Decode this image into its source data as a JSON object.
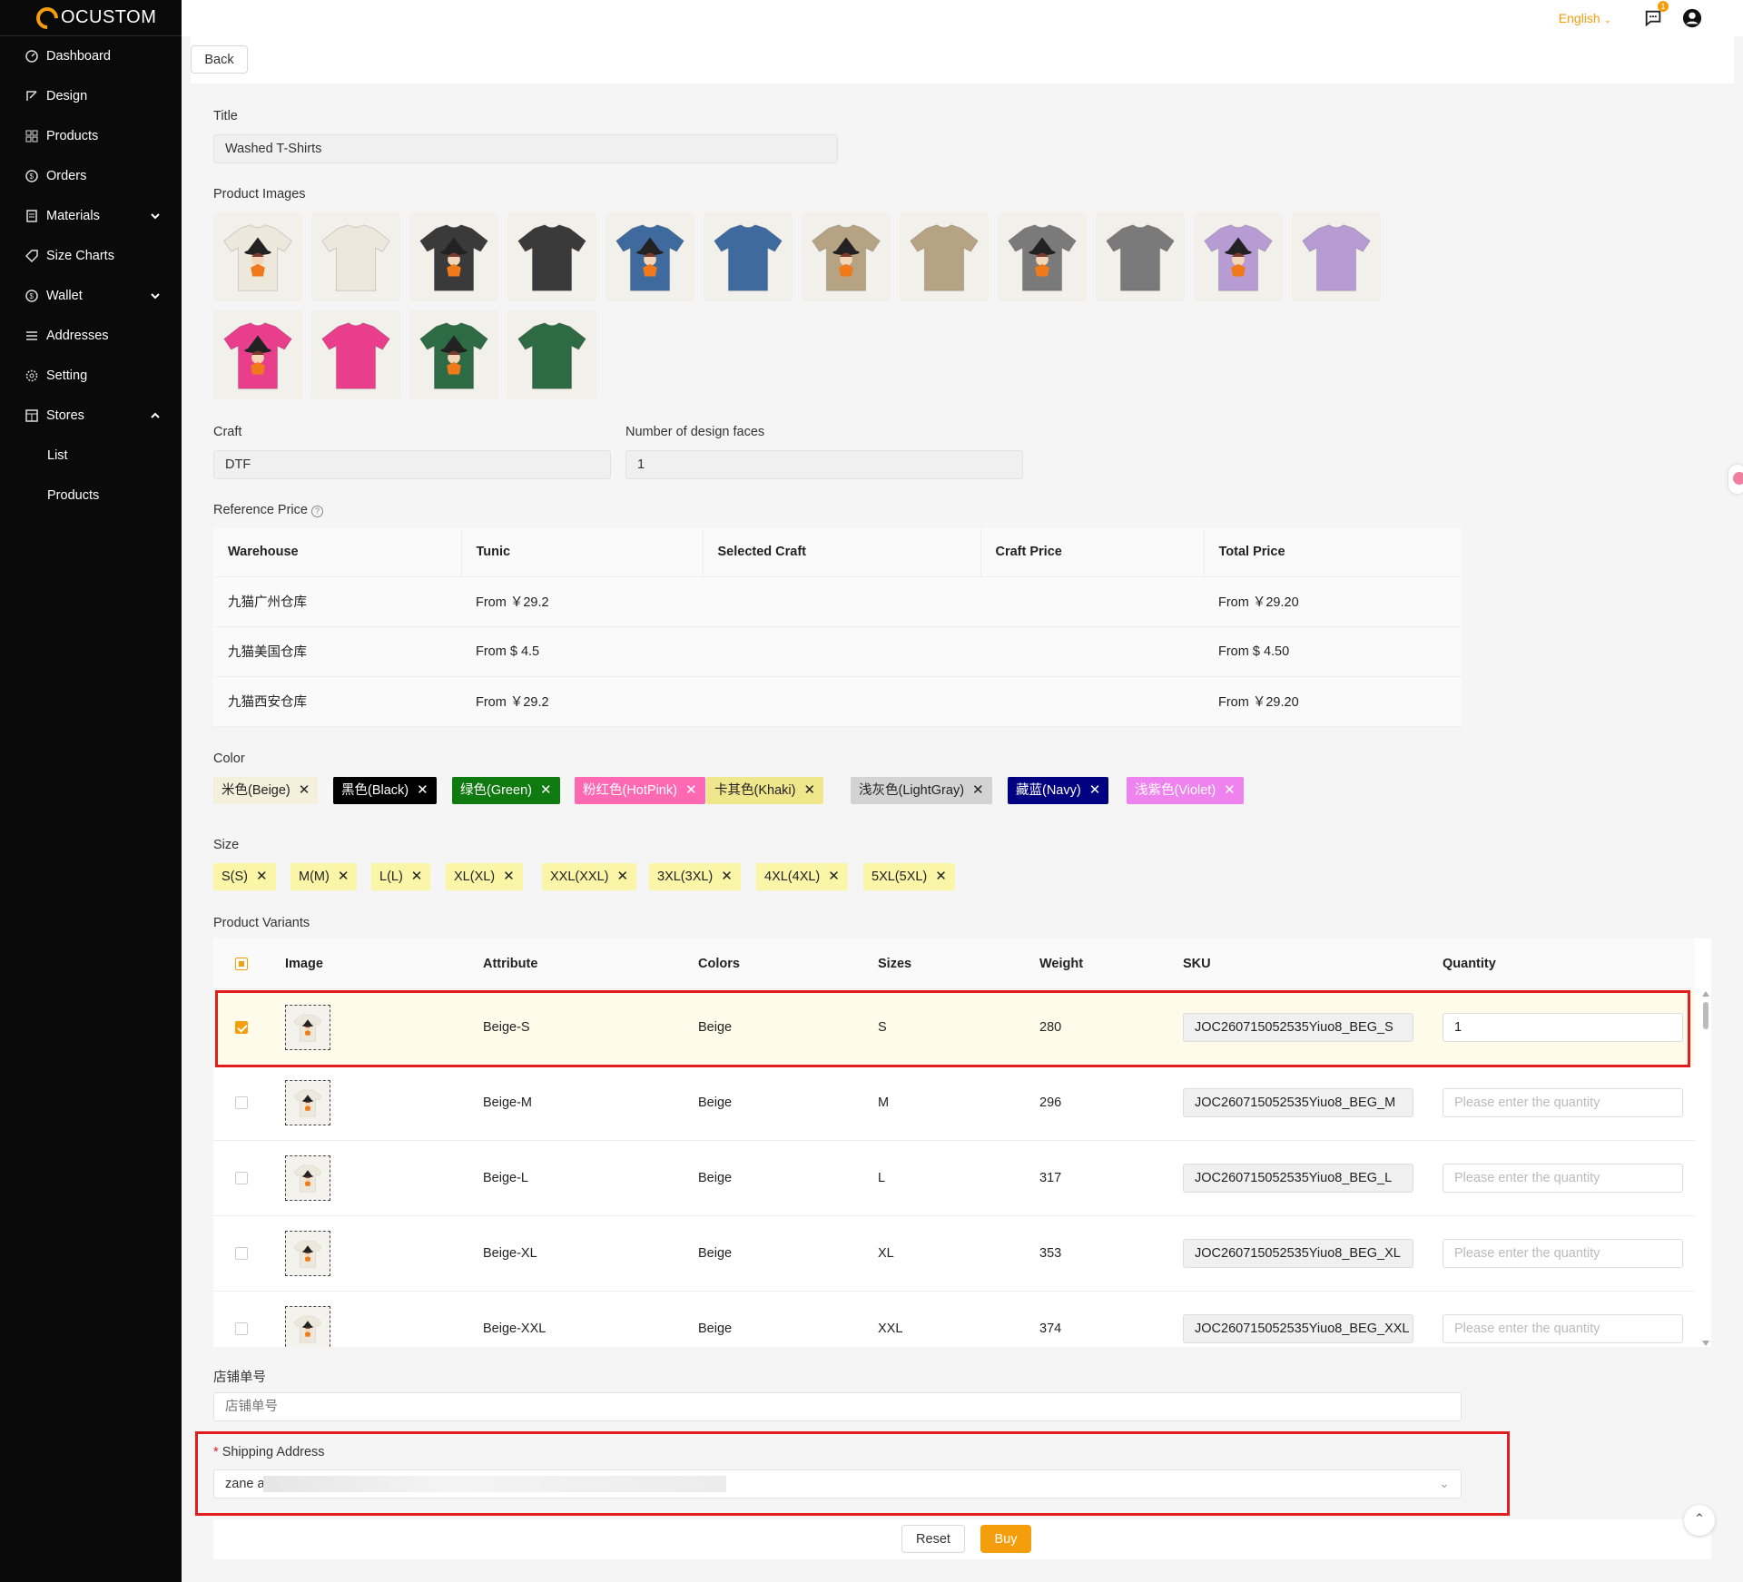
{
  "brand": {
    "name": "OCUSTOM",
    "accent": "#f59e0b"
  },
  "sidebar": {
    "items": [
      {
        "label": "Dashboard",
        "icon": "dashboard-icon"
      },
      {
        "label": "Design",
        "icon": "design-icon"
      },
      {
        "label": "Products",
        "icon": "products-icon"
      },
      {
        "label": "Orders",
        "icon": "orders-icon"
      },
      {
        "label": "Materials",
        "icon": "materials-icon",
        "chevron": "down"
      },
      {
        "label": "Size Charts",
        "icon": "tag-icon"
      },
      {
        "label": "Wallet",
        "icon": "wallet-icon",
        "chevron": "down"
      },
      {
        "label": "Addresses",
        "icon": "list-icon"
      },
      {
        "label": "Setting",
        "icon": "gear-icon"
      },
      {
        "label": "Stores",
        "icon": "store-icon",
        "chevron": "up"
      }
    ],
    "sub": [
      "List",
      "Products"
    ]
  },
  "topbar": {
    "language": "English",
    "badge_count": "1"
  },
  "toolbar": {
    "back": "Back"
  },
  "form": {
    "title_label": "Title",
    "title_value": "Washed T-Shirts",
    "images_label": "Product Images",
    "craft_label": "Craft",
    "craft_value": "DTF",
    "faces_label": "Number of design faces",
    "faces_value": "1",
    "ref_label": "Reference Price",
    "color_label": "Color",
    "size_label": "Size",
    "variants_label": "Product Variants",
    "store_no_label": "店铺单号",
    "store_no_placeholder": "店铺单号",
    "ship_required": "*",
    "ship_label": "Shipping Address",
    "ship_value": "zane a"
  },
  "images": [
    {
      "color": "#ece8dc",
      "design": true
    },
    {
      "color": "#ece8dc",
      "design": false
    },
    {
      "color": "#3a3a3a",
      "design": true
    },
    {
      "color": "#3a3a3a",
      "design": false
    },
    {
      "color": "#3f6a9e",
      "design": true
    },
    {
      "color": "#3f6a9e",
      "design": false
    },
    {
      "color": "#b6a383",
      "design": true
    },
    {
      "color": "#b6a383",
      "design": false
    },
    {
      "color": "#7a7a7a",
      "design": true
    },
    {
      "color": "#7a7a7a",
      "design": false
    },
    {
      "color": "#b69cd3",
      "design": true
    },
    {
      "color": "#b69cd3",
      "design": false
    },
    {
      "color": "#e83e8c",
      "design": true
    },
    {
      "color": "#e83e8c",
      "design": false
    },
    {
      "color": "#2e6b44",
      "design": true
    },
    {
      "color": "#2e6b44",
      "design": false
    }
  ],
  "ref_table": {
    "headers": [
      "Warehouse",
      "Tunic",
      "Selected Craft",
      "Craft Price",
      "Total Price"
    ],
    "rows": [
      [
        "九猫广州仓库",
        "From ￥29.2",
        "",
        "",
        "From ￥29.20"
      ],
      [
        "九猫美国仓库",
        "From $ 4.5",
        "",
        "",
        "From $ 4.50"
      ],
      [
        "九猫西安仓库",
        "From ￥29.2",
        "",
        "",
        "From ￥29.20"
      ]
    ]
  },
  "colors": [
    {
      "label": "米色(Beige)",
      "bg": "#f5f0dc",
      "fg": "#222"
    },
    {
      "label": "黑色(Black)",
      "bg": "#000000",
      "fg": "#fff"
    },
    {
      "label": "绿色(Green)",
      "bg": "#0f7a0f",
      "fg": "#fff"
    },
    {
      "label": "粉红色(HotPink)",
      "bg": "#ff69b4",
      "fg": "#fff"
    },
    {
      "label": "卡其色(Khaki)",
      "bg": "#f0e68c",
      "fg": "#222"
    },
    {
      "label": "浅灰色(LightGray)",
      "bg": "#d3d3d3",
      "fg": "#222"
    },
    {
      "label": "藏蓝(Navy)",
      "bg": "#000080",
      "fg": "#fff"
    },
    {
      "label": "浅紫色(Violet)",
      "bg": "#ee82ee",
      "fg": "#fff"
    }
  ],
  "sizes": [
    "S(S)",
    "M(M)",
    "L(L)",
    "XL(XL)",
    "XXL(XXL)",
    "3XL(3XL)",
    "4XL(4XL)",
    "5XL(5XL)"
  ],
  "variants": {
    "headers": [
      "Image",
      "Attribute",
      "Colors",
      "Sizes",
      "Weight",
      "SKU",
      "Quantity"
    ],
    "qty_placeholder": "Please enter the quantity",
    "rows": [
      {
        "attr": "Beige-S",
        "color": "Beige",
        "size": "S",
        "weight": "280",
        "sku": "JOC260715052535Yiuo8_BEG_S",
        "qty": "1",
        "checked": true
      },
      {
        "attr": "Beige-M",
        "color": "Beige",
        "size": "M",
        "weight": "296",
        "sku": "JOC260715052535Yiuo8_BEG_M",
        "qty": "",
        "checked": false
      },
      {
        "attr": "Beige-L",
        "color": "Beige",
        "size": "L",
        "weight": "317",
        "sku": "JOC260715052535Yiuo8_BEG_L",
        "qty": "",
        "checked": false
      },
      {
        "attr": "Beige-XL",
        "color": "Beige",
        "size": "XL",
        "weight": "353",
        "sku": "JOC260715052535Yiuo8_BEG_XL",
        "qty": "",
        "checked": false
      },
      {
        "attr": "Beige-XXL",
        "color": "Beige",
        "size": "XXL",
        "weight": "374",
        "sku": "JOC260715052535Yiuo8_BEG_XXL",
        "qty": "",
        "checked": false
      }
    ]
  },
  "actions": {
    "reset": "Reset",
    "buy": "Buy"
  }
}
